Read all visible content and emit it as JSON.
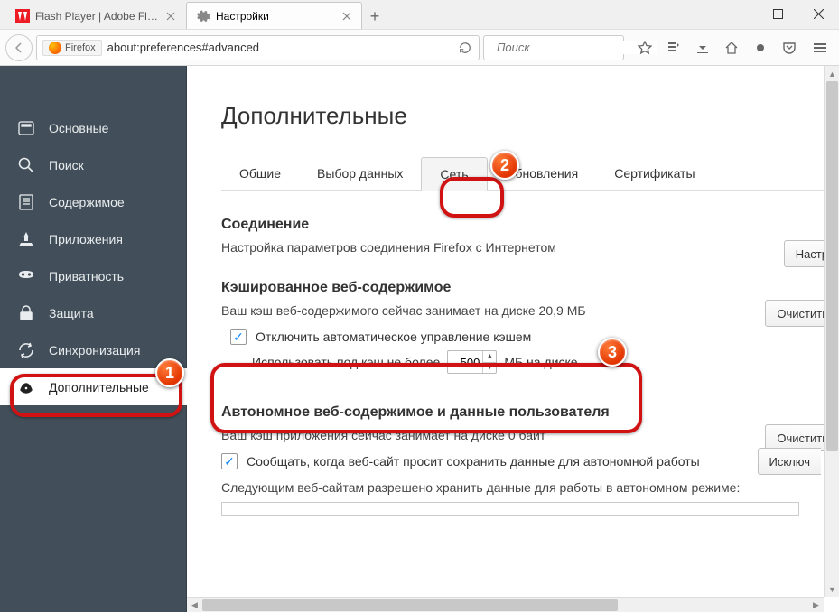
{
  "window": {
    "tabs": [
      {
        "label": "Flash Player | Adobe Flash ..."
      },
      {
        "label": "Настройки"
      }
    ]
  },
  "toolbar": {
    "identity": "Firefox",
    "url": "about:preferences#advanced",
    "search_placeholder": "Поиск"
  },
  "sidebar": {
    "items": [
      {
        "label": "Основные"
      },
      {
        "label": "Поиск"
      },
      {
        "label": "Содержимое"
      },
      {
        "label": "Приложения"
      },
      {
        "label": "Приватность"
      },
      {
        "label": "Защита"
      },
      {
        "label": "Синхронизация"
      },
      {
        "label": "Дополнительные"
      }
    ]
  },
  "content": {
    "title": "Дополнительные",
    "tabs": [
      {
        "label": "Общие"
      },
      {
        "label": "Выбор данных"
      },
      {
        "label": "Сеть"
      },
      {
        "label": "Обновления"
      },
      {
        "label": "Сертификаты"
      }
    ],
    "connection": {
      "title": "Соединение",
      "desc": "Настройка параметров соединения Firefox с Интернетом",
      "btn": "Настр"
    },
    "cache": {
      "title": "Кэшированное веб-содержимое",
      "desc": "Ваш кэш веб-содержимого сейчас занимает на диске 20,9 МБ",
      "btn": "Очистить",
      "disable_label": "Отключить автоматическое управление кэшем",
      "limit_prefix": "Использовать под кэш не более",
      "limit_value": "500",
      "limit_suffix": "МБ на диске"
    },
    "offline": {
      "title": "Автономное веб-содержимое и данные пользователя",
      "desc": "Ваш кэш приложения сейчас занимает на диске 0 байт",
      "btn": "Очистить",
      "notify_label": "Сообщать, когда веб-сайт просит сохранить данные для автономной работы",
      "exceptions_btn": "Исключ",
      "sites_desc": "Следующим веб-сайтам разрешено хранить данные для работы в автономном режиме:"
    }
  },
  "callouts": {
    "n1": "1",
    "n2": "2",
    "n3": "3"
  }
}
